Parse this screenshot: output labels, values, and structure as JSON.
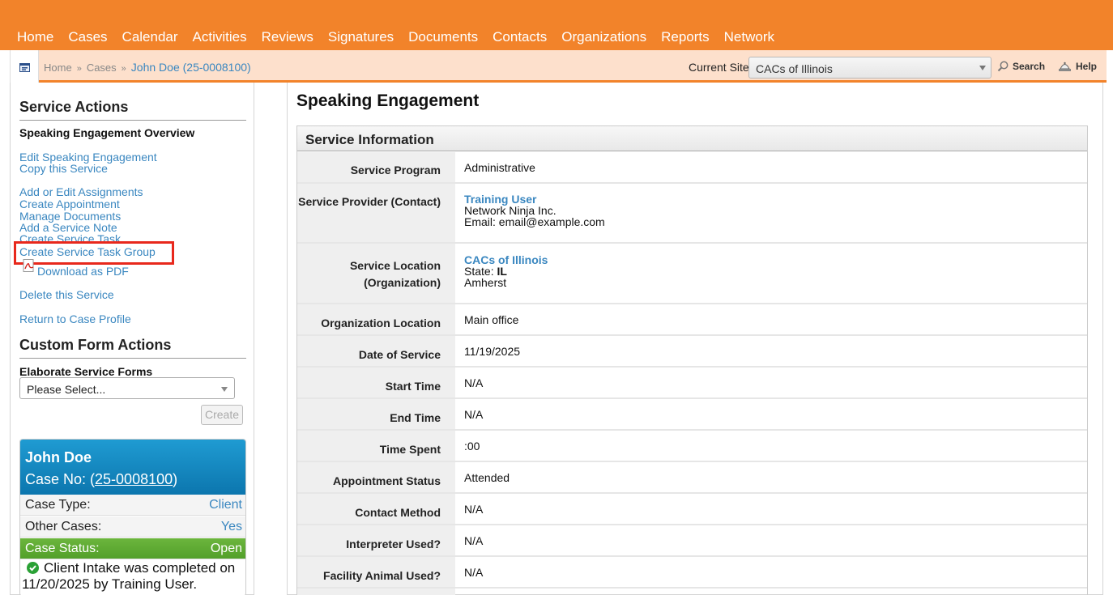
{
  "nav": [
    "Home",
    "Cases",
    "Calendar",
    "Activities",
    "Reviews",
    "Signatures",
    "Documents",
    "Contacts",
    "Organizations",
    "Reports",
    "Network"
  ],
  "breadcrumb": {
    "home": "Home",
    "sep": "»",
    "cases": "Cases",
    "current": "John Doe (25-0008100)"
  },
  "site": {
    "label": "Current Site",
    "value": "CACs of Illinois"
  },
  "toolbar": {
    "search": "Search",
    "help": "Help"
  },
  "service_actions": {
    "title": "Service Actions",
    "overview": "Speaking Engagement Overview",
    "links": {
      "edit": "Edit Speaking Engagement",
      "copy": "Copy this Service",
      "assign": "Add or Edit Assignments",
      "appointment": "Create Appointment",
      "documents": "Manage Documents",
      "note": "Add a Service Note",
      "task": "Create Service Task",
      "task_group": "Create Service Task Group",
      "pdf": "Download as PDF",
      "delete": "Delete this Service",
      "return": "Return to Case Profile"
    }
  },
  "custom_form": {
    "title": "Custom Form Actions",
    "subtitle": "Elaborate Service Forms",
    "select_value": "Please Select...",
    "create": "Create"
  },
  "case_card": {
    "name": "John Doe",
    "case_label": "Case No: (",
    "case_number": "25-0008100",
    "case_close": ")",
    "type_label": "Case Type:",
    "type_value": "Client",
    "other_label": "Other Cases:",
    "other_value": "Yes",
    "status_label": "Case Status:",
    "status_value": "Open",
    "note": "Client Intake was completed on 11/20/2025 by Training User."
  },
  "page_title": "Speaking Engagement",
  "service_info": {
    "title": "Service Information",
    "program_label": "Service Program",
    "program_value": "Administrative",
    "provider_label": "Service Provider (Contact)",
    "provider_name": "Training User",
    "provider_org": "Network Ninja Inc.",
    "provider_email": "Email: email@example.com",
    "location_label_1": "Service Location",
    "location_label_2": "(Organization)",
    "location_name": "CACs of Illinois",
    "location_state_label": "State: ",
    "location_state": "IL",
    "location_city": "Amherst",
    "org_location_label": "Organization Location",
    "org_location_value": "Main office",
    "date_label": "Date of Service",
    "date_value": "11/19/2025",
    "start_label": "Start Time",
    "start_value": "N/A",
    "end_label": "End Time",
    "end_value": "N/A",
    "spent_label": "Time Spent",
    "spent_value": ":00",
    "appt_label": "Appointment Status",
    "appt_value": "Attended",
    "contact_label": "Contact Method",
    "contact_value": "N/A",
    "interp_label": "Interpreter Used?",
    "interp_value": "N/A",
    "animal_label": "Facility Animal Used?",
    "animal_value": "N/A"
  },
  "colors": {
    "nav_bg": "#f2832a",
    "link": "#3a87c0",
    "highlight": "#e8281c",
    "status_green": "#52a02a",
    "card_blue": "#0c76ae"
  }
}
